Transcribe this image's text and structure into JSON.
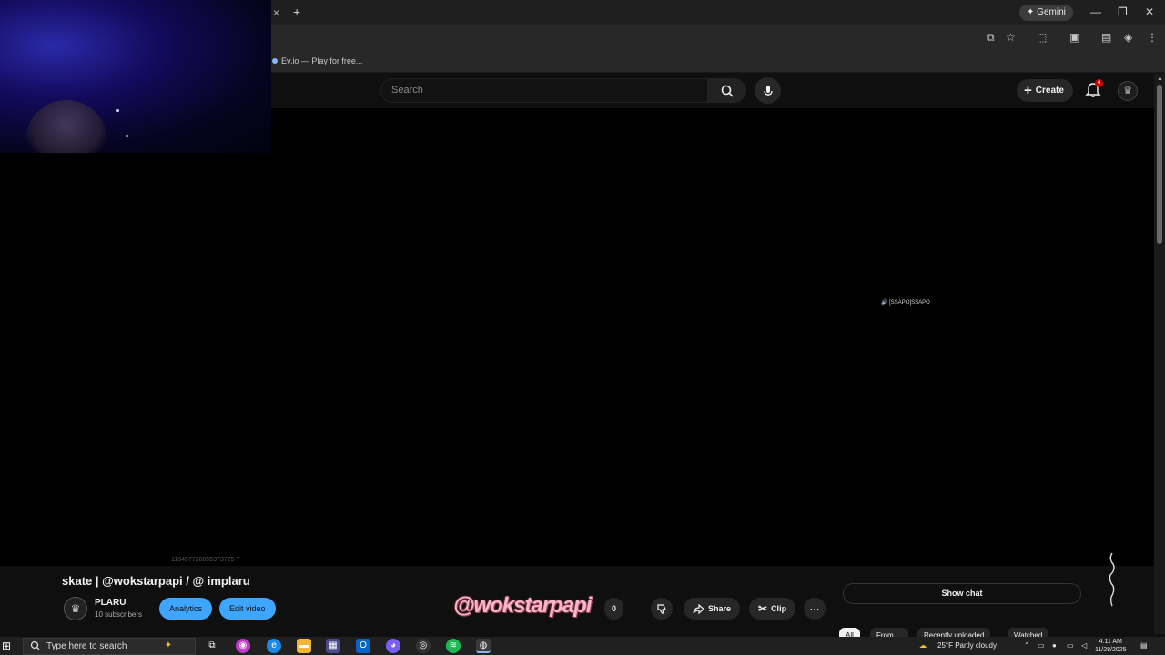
{
  "browser": {
    "new_tab_symbol": "+",
    "tab_close_symbol": "×",
    "gemini_label": "Gemini",
    "bookmark_label": "Ev.io — Play for free..."
  },
  "youtube": {
    "search_placeholder": "Search",
    "create_label": "Create",
    "notification_count": "4"
  },
  "player": {
    "caption_text": "🔊 [SSAPO]SSAPO",
    "id_text": "118457720855973725 7"
  },
  "video": {
    "title": "skate | @wokstarpapi / @ implaru",
    "channel_name": "PLARU",
    "subscribers": "10 subscribers",
    "analytics_label": "Analytics",
    "edit_label": "Edit video",
    "share_label": "Share",
    "clip_label": "Clip",
    "like_count_partial": "0",
    "watermark_text": "@wokstarpapi"
  },
  "sidebar": {
    "show_chat_label": "Show chat",
    "chips": [
      "All",
      "From ...",
      "Recently uploaded",
      "Watched"
    ]
  },
  "taskbar": {
    "search_placeholder": "Type here to search",
    "weather": "25°F  Partly cloudy",
    "time": "4:11 AM",
    "date": "11/28/2025"
  },
  "colors": {
    "accent_blue": "#3ea6ff",
    "notification_red": "#cc0000",
    "watermark_pink": "#f7b7c7"
  }
}
